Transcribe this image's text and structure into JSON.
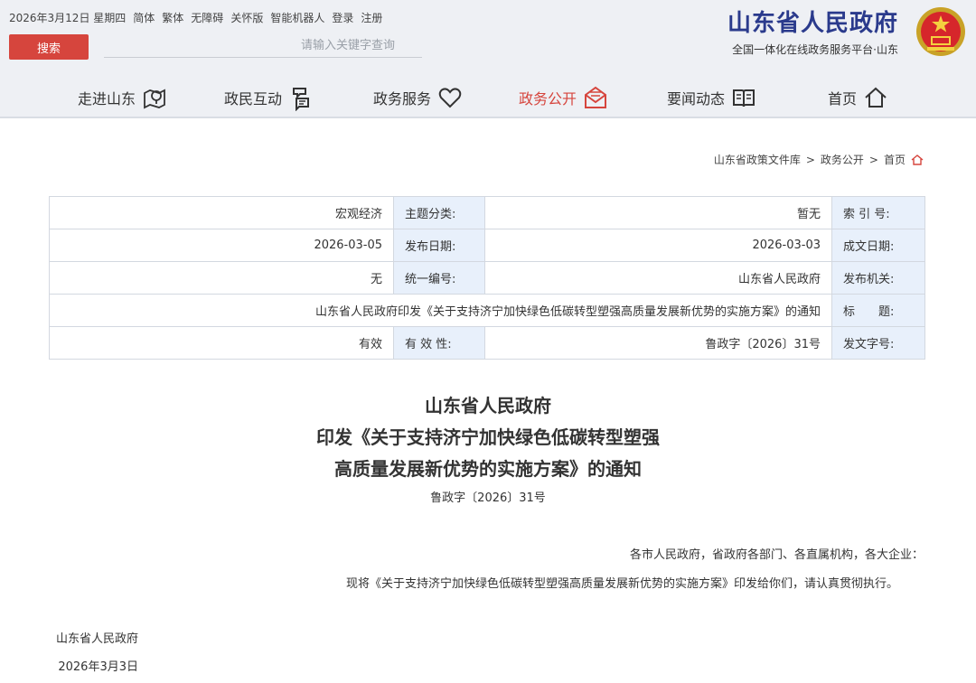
{
  "header": {
    "utility_links": [
      "2026年3月12日 星期四",
      "简体",
      "繁体",
      "无障碍",
      "关怀版",
      "智能机器人",
      "登录",
      "注册"
    ],
    "search_button": "搜索",
    "search_placeholder": "请输入关键字查询",
    "brand_title": "山东省人民政府",
    "brand_subtitle": "全国一体化在线政务服务平台·山东",
    "emblem_icon": "national-emblem-icon"
  },
  "nav": {
    "items": [
      {
        "label": "首页",
        "icon": "home-icon"
      },
      {
        "label": "要闻动态",
        "icon": "book-icon"
      },
      {
        "label": "政务公开",
        "icon": "open-mail-icon",
        "active": true
      },
      {
        "label": "政务服务",
        "icon": "heart-icon"
      },
      {
        "label": "政民互动",
        "icon": "interaction-icon"
      },
      {
        "label": "走进山东",
        "icon": "map-pin-icon"
      }
    ],
    "active_color": "#d6453d"
  },
  "breadcrumb": {
    "home": "首页",
    "sep": ">",
    "level1": "政务公开",
    "level2": "山东省政策文件库"
  },
  "meta": {
    "rows": [
      {
        "l1": "索 引 号:",
        "v1": "暂无",
        "l2": "主题分类:",
        "v2": "宏观经济"
      },
      {
        "l1": "成文日期:",
        "v1": "2026-03-03",
        "l2": "发布日期:",
        "v2": "2026-03-05"
      },
      {
        "l1": "发布机关:",
        "v1": "山东省人民政府",
        "l2": "统一编号:",
        "v2": "无"
      },
      {
        "l1": "标　　题:",
        "v1": "山东省人民政府印发《关于支持济宁加快绿色低碳转型塑强高质量发展新优势的实施方案》的通知"
      },
      {
        "l1": "发文字号:",
        "v1": "鲁政字〔2026〕31号",
        "l2": "有 效 性:",
        "v2": "有效"
      }
    ]
  },
  "document": {
    "title_lines": [
      "山东省人民政府",
      "印发《关于支持济宁加快绿色低碳转型塑强",
      "高质量发展新优势的实施方案》的通知"
    ],
    "doc_no": "鲁政字〔2026〕31号",
    "salutation": "各市人民政府，省政府各部门、各直属机构，各大企业：",
    "body": "现将《关于支持济宁加快绿色低碳转型塑强高质量发展新优势的实施方案》印发给你们，请认真贯彻执行。",
    "signer": "山东省人民政府",
    "date": "2026年3月3日"
  }
}
